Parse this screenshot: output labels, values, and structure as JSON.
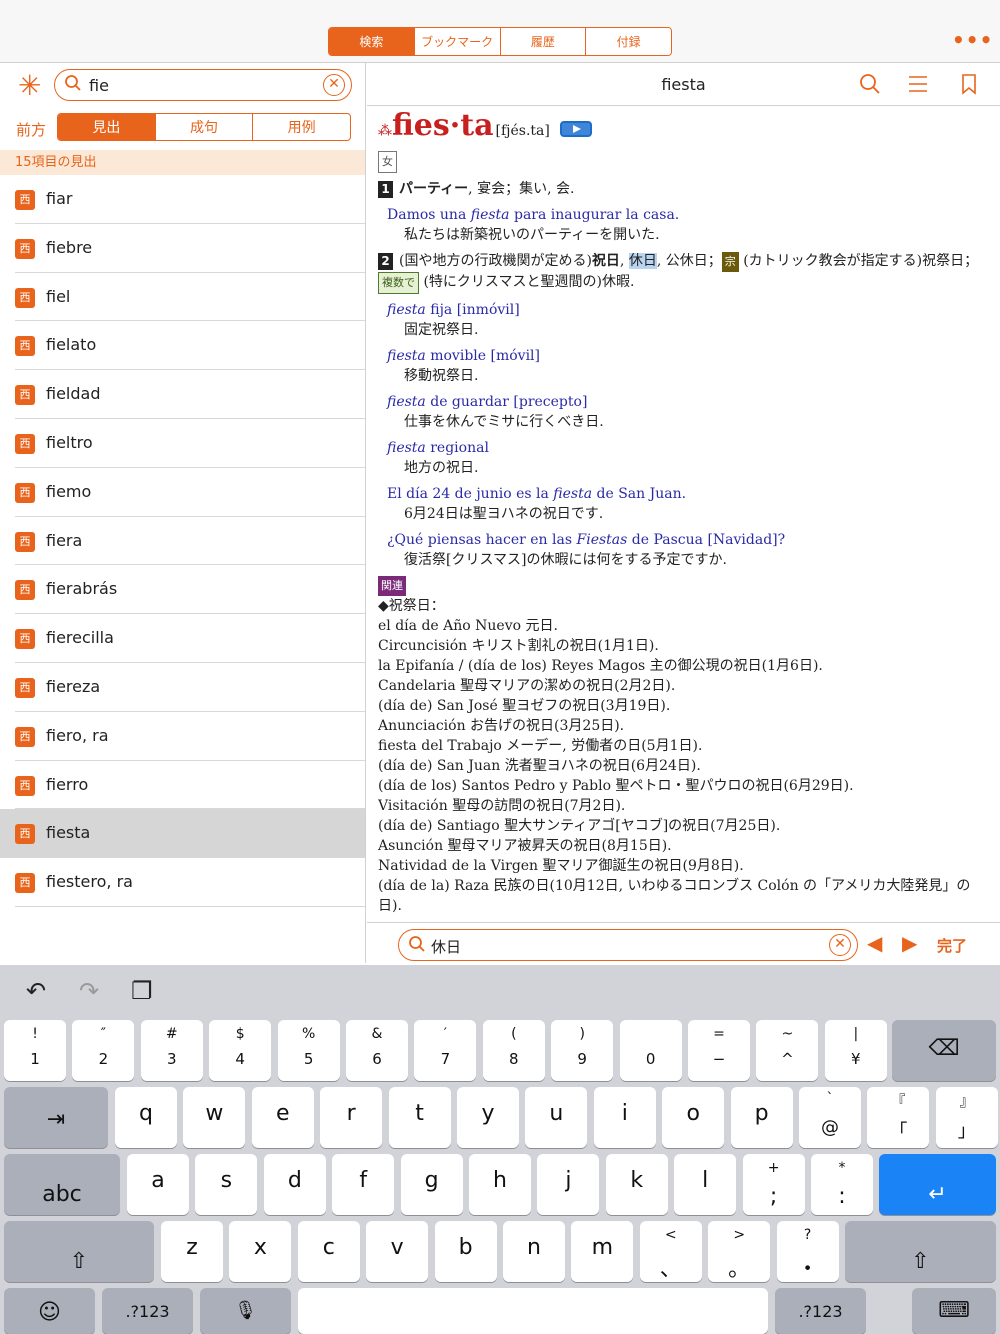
{
  "top_tabs": [
    "検索",
    "ブックマーク",
    "履歴",
    "付録"
  ],
  "more_label": "•••",
  "left": {
    "search_value": "fie",
    "front_label": "前方",
    "segments": [
      "見出",
      "成句",
      "用例"
    ],
    "count_text": "15項目の見出",
    "badge": "西",
    "items": [
      "fiar",
      "fiebre",
      "fiel",
      "fielato",
      "fieldad",
      "fieltro",
      "fiemo",
      "fiera",
      "fierabrás",
      "fierecilla",
      "fiereza",
      "fiero, ra",
      "fierro",
      "fiesta",
      "fiestero, ra"
    ],
    "selected_index": 13
  },
  "right": {
    "title": "fiesta",
    "headword_stars": "⁂",
    "headword": "fies·ta",
    "pronunciation": "[fjés.ta]",
    "gender": "女",
    "sense1": {
      "num": "1",
      "bold": "パーティー",
      "rest": ", 宴会；集い, 会."
    },
    "ex1": {
      "es_a": "Damos una ",
      "es_i": "fiesta",
      "es_b": " para inaugurar la casa.",
      "ja": "私たちは新築祝いのパーティーを開いた."
    },
    "sense2": {
      "num": "2",
      "a": "(国や地方の行政機関が定める)",
      "b": "祝日",
      "c": ", ",
      "hl": "休日",
      "d": ", 公休日；",
      "tag": "宗",
      "e": " (カトリック教会が指定する)祝祭日；",
      "tag2": "複数で",
      "f": " (特にクリスマスと聖週間の)休暇."
    },
    "phrases": [
      {
        "i": "fiesta",
        "rest": " fija [inmóvil]",
        "ja": "固定祝祭日."
      },
      {
        "i": "fiesta",
        "rest": " movible [móvil]",
        "ja": "移動祝祭日."
      },
      {
        "i": "fiesta",
        "rest": " de guardar [precepto]",
        "ja": "仕事を休んでミサに行くべき日."
      },
      {
        "i": "fiesta",
        "rest": " regional",
        "ja": "地方の祝日."
      }
    ],
    "ex2": {
      "es_a": "El día 24 de junio es la ",
      "es_i": "fiesta",
      "es_b": " de San Juan.",
      "ja": "6月24日は聖ヨハネの祝日です."
    },
    "ex3": {
      "es_a": "¿Qué piensas hacer en las ",
      "es_i": "Fiestas",
      "es_b": " de Pascua [Navidad]?",
      "ja": "復活祭[クリスマス]の休暇には何をする予定ですか."
    },
    "related_tag": "関連",
    "related_heading": "◆祝祭日：",
    "related": [
      "el día de Año Nuevo 元日.",
      "Circuncisión キリスト割礼の祝日(1月1日).",
      "la Epifanía / (día de los) Reyes Magos 主の御公現の祝日(1月6日).",
      "Candelaria 聖母マリアの潔めの祝日(2月2日).",
      "(día de) San José 聖ヨゼフの祝日(3月19日).",
      "Anunciación お告げの祝日(3月25日).",
      "fiesta del Trabajo メーデー, 労働者の日(5月1日).",
      "(día de) San Juan 洗者聖ヨハネの祝日(6月24日).",
      "(día de los) Santos Pedro y Pablo 聖ペトロ・聖パウロの祝日(6月29日).",
      "Visitación 聖母の訪問の祝日(7月2日).",
      "(día de) Santiago 聖大サンティアゴ[ヤコブ]の祝日(7月25日).",
      "Asunción 聖母マリア被昇天の祝日(8月15日).",
      "Natividad de la Virgen 聖マリア御誕生の祝日(9月8日).",
      "(día de la) Raza 民族の日(10月12日, いわゆるコロンブス Colón の「アメリカ大陸発見」の",
      "日)."
    ]
  },
  "find": {
    "value": "休日",
    "prev": "◀",
    "next": "▶",
    "done": "完了"
  },
  "keyboard": {
    "row1": [
      [
        "!",
        "1"
      ],
      [
        "″",
        "2"
      ],
      [
        "#",
        "3"
      ],
      [
        "$",
        "4"
      ],
      [
        "%",
        "5"
      ],
      [
        "&",
        "6"
      ],
      [
        "′",
        "7"
      ],
      [
        "(",
        "8"
      ],
      [
        ")",
        "9"
      ],
      [
        "",
        "0"
      ],
      [
        "=",
        "−"
      ],
      [
        "~",
        "^"
      ],
      [
        "|",
        "¥"
      ]
    ],
    "row2": [
      [
        "",
        "q"
      ],
      [
        "",
        "w"
      ],
      [
        "",
        "e"
      ],
      [
        "",
        "r"
      ],
      [
        "",
        "t"
      ],
      [
        "",
        "y"
      ],
      [
        "",
        "u"
      ],
      [
        "",
        "i"
      ],
      [
        "",
        "o"
      ],
      [
        "",
        "p"
      ],
      [
        "`",
        "@"
      ],
      [
        "『",
        "「"
      ],
      [
        "』",
        "」"
      ]
    ],
    "row3": [
      [
        "",
        "a"
      ],
      [
        "",
        "s"
      ],
      [
        "",
        "d"
      ],
      [
        "",
        "f"
      ],
      [
        "",
        "g"
      ],
      [
        "",
        "h"
      ],
      [
        "",
        "j"
      ],
      [
        "",
        "k"
      ],
      [
        "",
        "l"
      ],
      [
        "+",
        ";"
      ],
      [
        "*",
        ":"
      ]
    ],
    "row4": [
      [
        "",
        "z"
      ],
      [
        "",
        "x"
      ],
      [
        "",
        "c"
      ],
      [
        "",
        "v"
      ],
      [
        "",
        "b"
      ],
      [
        "",
        "n"
      ],
      [
        "",
        "m"
      ],
      [
        "<",
        "、"
      ],
      [
        ">",
        "。"
      ],
      [
        "?",
        "・"
      ]
    ],
    "tab_label": "⇥",
    "abc_label": "abc",
    "num_label": ".?123",
    "delete_icon": "⌫",
    "return_icon": "↵",
    "shift_icon": "⇧",
    "emoji_icon": "☺",
    "mic_icon": "🎙",
    "hide_icon": "⌨",
    "undo_icon": "↶",
    "redo_icon": "↷",
    "paste_icon": "❐"
  }
}
